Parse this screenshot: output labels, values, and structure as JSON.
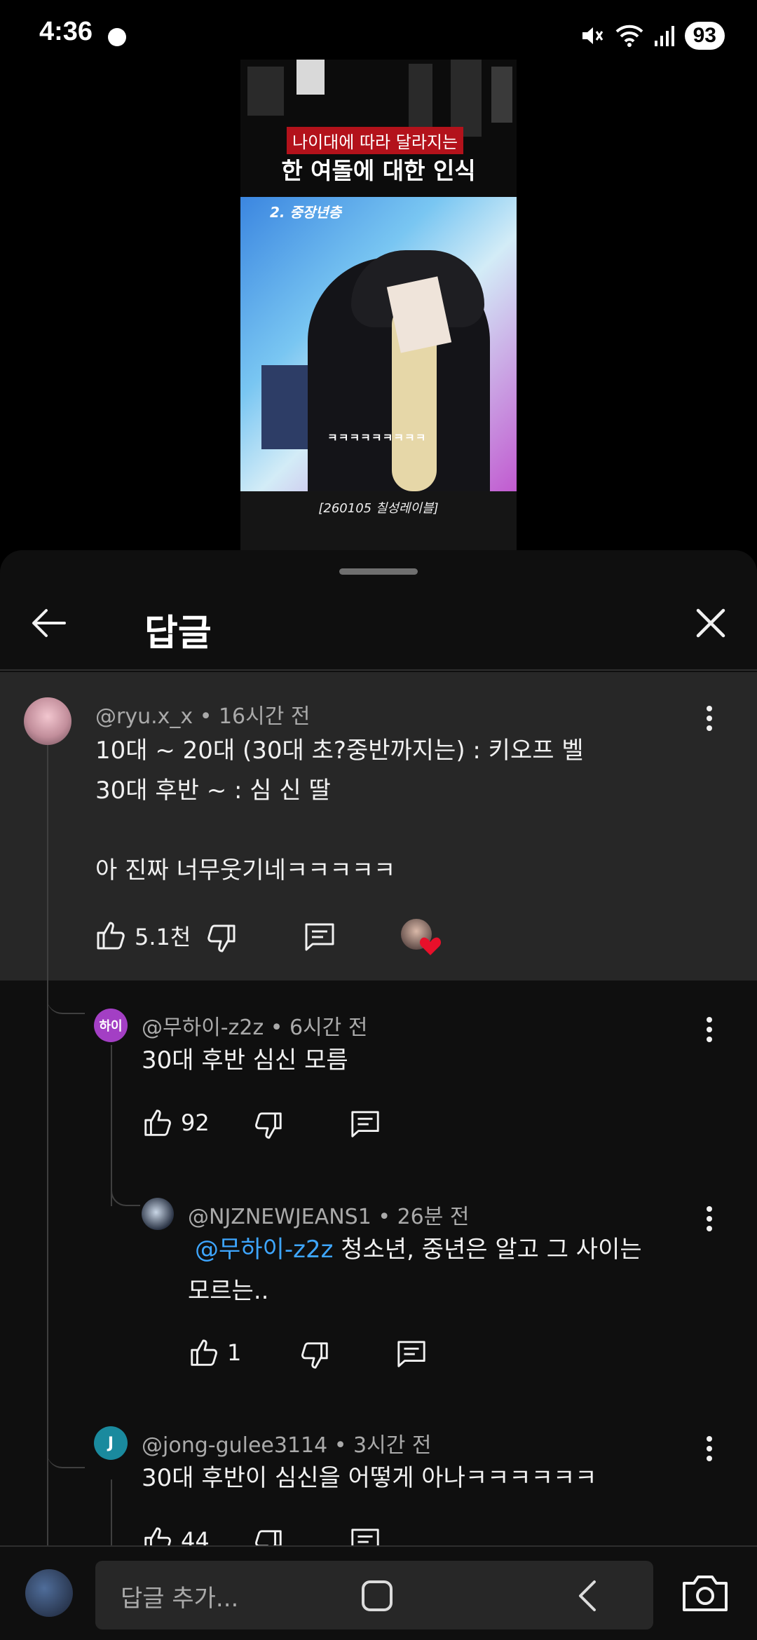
{
  "status_bar": {
    "time": "4:36",
    "battery": "93"
  },
  "video": {
    "caption_red": "나이대에 따라 달라지는",
    "caption_white": "한 여돌에 대한 인식",
    "section_tag": "2. 중장년층",
    "subtitle": "ㅋㅋㅋㅋㅋㅋㅋㅋㅋ",
    "bottom_caption": "[260105 칠성레이블]"
  },
  "sheet": {
    "title": "답글"
  },
  "comments": [
    {
      "author": "@ryu.x_x",
      "time": "16시간 전",
      "lines": [
        "10대 ~ 20대 (30대 초?중반까지는) : 키오프 벨",
        "30대 후반 ~ : 심 신 딸",
        "",
        "아 진짜 너무웃기네ㅋㅋㅋㅋㅋ"
      ],
      "likes": "5.1천"
    },
    {
      "author": "@무하이-z2z",
      "time": "6시간 전",
      "avatar_text": "하이",
      "avatar_color": "#a33fc4",
      "lines": [
        "30대 후반 심신 모름"
      ],
      "likes": "92"
    },
    {
      "author": "@NJZNEWJEANS1",
      "time": "26분 전",
      "mention": "@무하이-z2z",
      "line1_rest": " 청소년, 중년은 알고 그 사이는",
      "line2": "모르는..",
      "likes": "1"
    },
    {
      "author": "@jong-gulee3114",
      "time": "3시간 전",
      "avatar_text": "J",
      "avatar_color": "#1a8a9e",
      "lines": [
        "30대 후반이 심신을 어떻게 아나ㅋㅋㅋㅋㅋㅋ"
      ],
      "likes": "44"
    }
  ],
  "composer": {
    "placeholder": "답글 추가..."
  },
  "colors": {
    "background": "#0f0f0f",
    "highlight": "#272727",
    "mention": "#3ea6ff",
    "heart": "#e8102a"
  }
}
